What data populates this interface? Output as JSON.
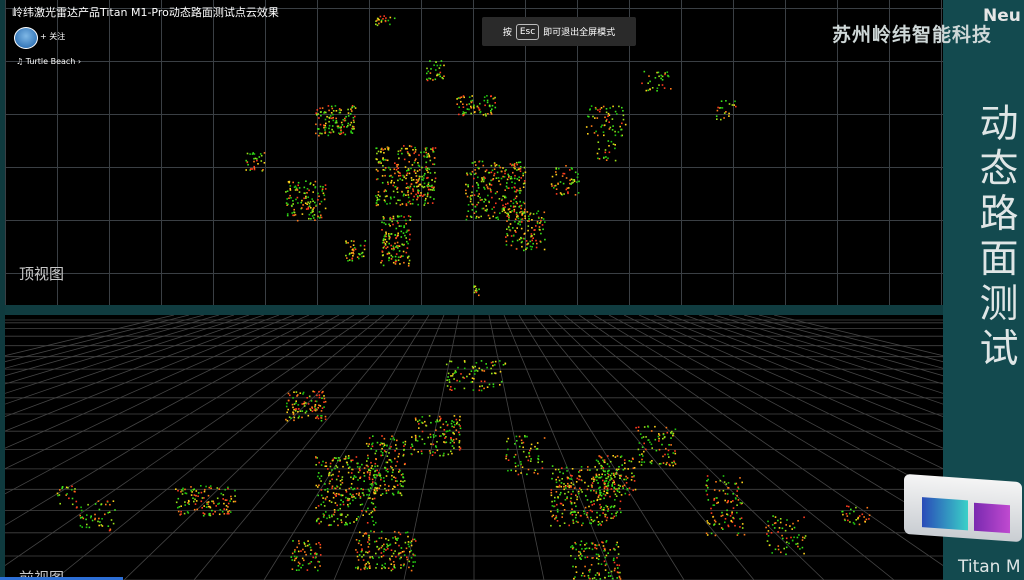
{
  "video": {
    "title": "岭纬激光雷达产品Titan M1-Pro动态路面测试点云效果",
    "follow_label": "+ 关注",
    "music": "Turtle Beach"
  },
  "banner": {
    "prefix": "按",
    "key": "Esc",
    "suffix": "即可退出全屏模式"
  },
  "overlay": {
    "company": "苏州岭纬智能科技",
    "corner": "Neu",
    "vertical_title": [
      "动",
      "态",
      "路",
      "面",
      "测",
      "试"
    ],
    "product": "Titan M"
  },
  "views": {
    "top_label": "顶视图",
    "front_label": "前视图"
  },
  "playback": {
    "progress": 0.12
  },
  "colors": {
    "panel": "#134a4f",
    "progress": "#2d6fd6"
  }
}
